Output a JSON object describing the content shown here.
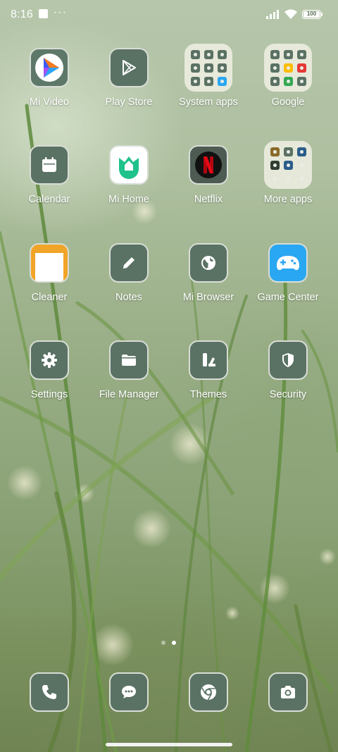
{
  "status_bar": {
    "time": "8:16",
    "notification_icon": "notification-square-icon",
    "more_icon": "more-dots-icon",
    "more_text": "···",
    "signal_icon": "cell-signal-icon",
    "wifi_icon": "wifi-icon",
    "battery_level": "100"
  },
  "home": {
    "rows": [
      [
        {
          "label": "Mi Video",
          "icon": "mi-video-icon"
        },
        {
          "label": "Play Store",
          "icon": "play-store-icon"
        },
        {
          "label": "System apps",
          "icon": "system-apps-folder-icon",
          "folder": true
        },
        {
          "label": "Google",
          "icon": "google-folder-icon",
          "folder": true
        }
      ],
      [
        {
          "label": "Calendar",
          "icon": "calendar-icon"
        },
        {
          "label": "Mi Home",
          "icon": "mi-home-icon"
        },
        {
          "label": "Netflix",
          "icon": "netflix-icon"
        },
        {
          "label": "More apps",
          "icon": "more-apps-folder-icon",
          "folder": true
        }
      ],
      [
        {
          "label": "Cleaner",
          "icon": "cleaner-icon"
        },
        {
          "label": "Notes",
          "icon": "notes-pencil-icon"
        },
        {
          "label": "Mi Browser",
          "icon": "globe-icon"
        },
        {
          "label": "Game Center",
          "icon": "gamepad-icon"
        }
      ],
      [
        {
          "label": "Settings",
          "icon": "gear-icon"
        },
        {
          "label": "File Manager",
          "icon": "folder-icon"
        },
        {
          "label": "Themes",
          "icon": "themes-icon"
        },
        {
          "label": "Security",
          "icon": "shield-icon"
        }
      ]
    ]
  },
  "page_indicator": {
    "pages": 2,
    "current": 2
  },
  "dock": [
    {
      "icon": "phone-icon"
    },
    {
      "icon": "messages-icon"
    },
    {
      "icon": "chrome-icon"
    },
    {
      "icon": "camera-icon"
    }
  ],
  "colors": {
    "tile_bg": "#5a7264",
    "tile_border": "#d8ddd6",
    "label": "#ffffff",
    "netflix_red": "#e50914",
    "mi_video_orange": "#f57c1f",
    "mi_video_blue": "#3b5bf5",
    "mi_home_green": "#1fc28a",
    "game_center_blue": "#2aa7f2"
  }
}
